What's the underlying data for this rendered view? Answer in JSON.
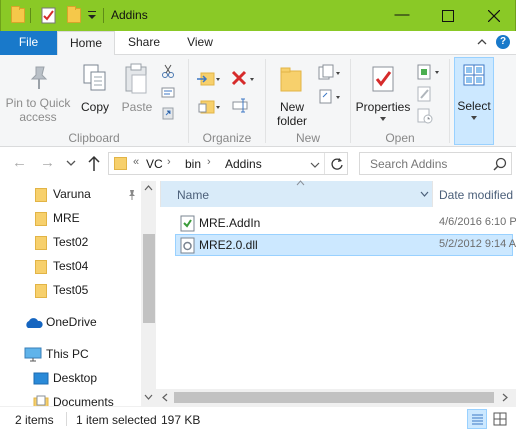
{
  "window": {
    "title": "Addins",
    "controls": {
      "minimize_icon": "minimize-icon",
      "maximize_icon": "maximize-icon",
      "close_icon": "close-icon"
    }
  },
  "ribbon_tabs": [
    {
      "label": "File"
    },
    {
      "label": "Home"
    },
    {
      "label": "Share"
    },
    {
      "label": "View"
    }
  ],
  "ribbon": {
    "clipboard": {
      "group_label": "Clipboard",
      "pin_label_line1": "Pin to Quick",
      "pin_label_line2": "access",
      "copy_label": "Copy",
      "paste_label": "Paste"
    },
    "organize": {
      "group_label": "Organize"
    },
    "new": {
      "group_label": "New",
      "new_folder_line1": "New",
      "new_folder_line2": "folder"
    },
    "open": {
      "group_label": "Open",
      "properties_label": "Properties"
    },
    "select": {
      "select_label": "Select"
    }
  },
  "address": {
    "overflow": "«",
    "breadcrumbs": [
      "VC",
      "bin",
      "Addins"
    ],
    "search_placeholder": "Search Addins"
  },
  "nav_pane": {
    "quick_access": [
      "Varuna",
      "MRE",
      "Test02",
      "Test04",
      "Test05"
    ],
    "onedrive": "OneDrive",
    "this_pc": "This PC",
    "pc_items": [
      "Desktop",
      "Documents"
    ]
  },
  "file_list": {
    "columns": {
      "name": "Name",
      "date_modified": "Date modified"
    },
    "files": [
      {
        "name": "MRE.AddIn",
        "date": "4/6/2016 6:10 P",
        "icon": "addin-file-icon",
        "selected": false
      },
      {
        "name": "MRE2.0.dll",
        "date": "5/2/2012 9:14 A",
        "icon": "dll-file-icon",
        "selected": true
      }
    ]
  },
  "status": {
    "item_count": "2 items",
    "selection": "1 item selected",
    "size": "197 KB"
  },
  "colors": {
    "titlebar": "#8ac926",
    "file_tab": "#1979ca",
    "selection": "#cce8ff",
    "selection_border": "#99d1ff"
  }
}
